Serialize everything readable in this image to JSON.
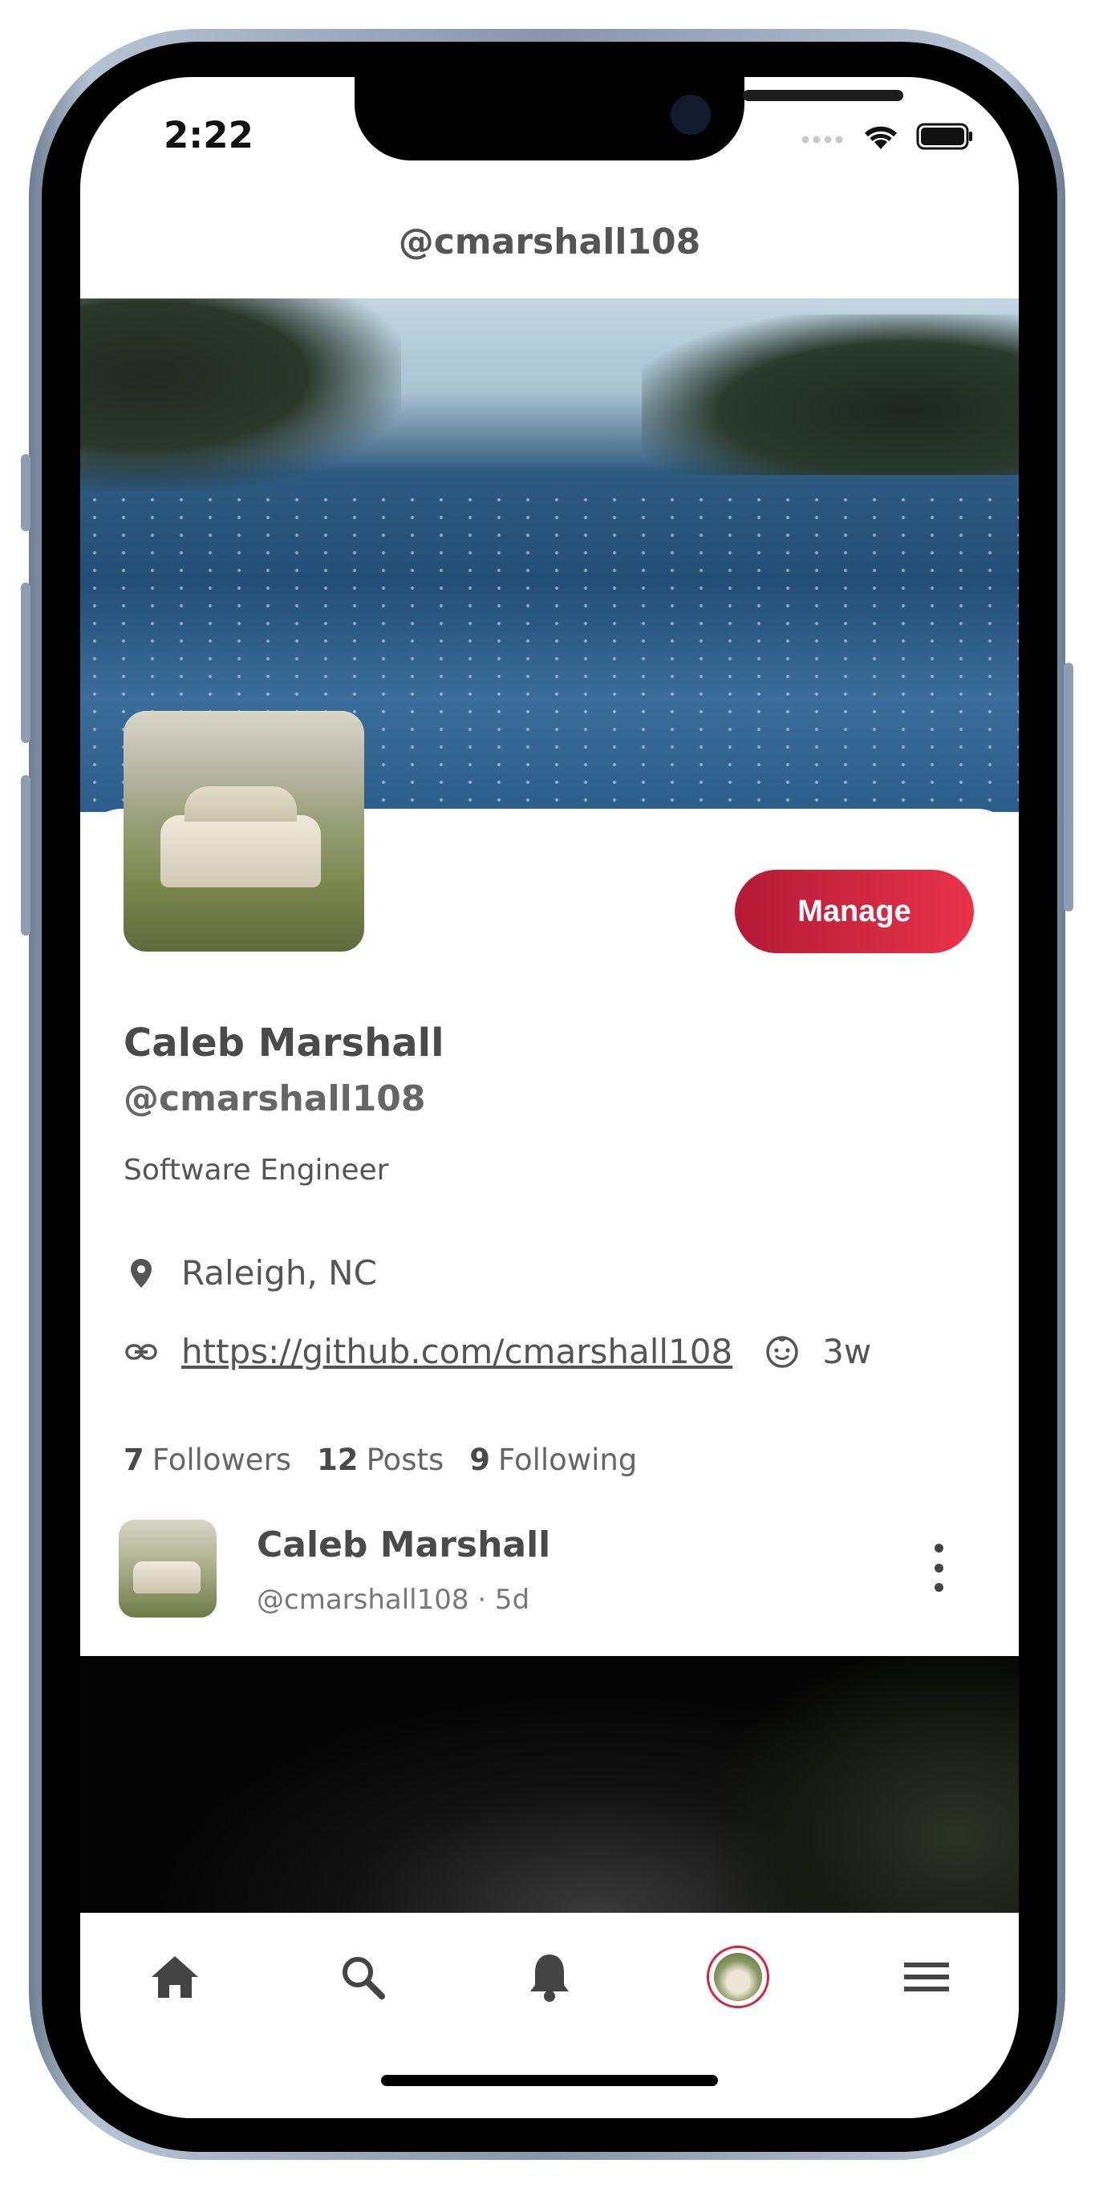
{
  "status_bar": {
    "time": "2:22"
  },
  "header": {
    "title": "@cmarshall108"
  },
  "profile": {
    "manage_label": "Manage",
    "name": "Caleb Marshall",
    "handle": "@cmarshall108",
    "bio": "Software Engineer",
    "location": "Raleigh, NC",
    "website": "https://github.com/cmarshall108",
    "joined": "3w"
  },
  "stats": {
    "followers_count": "7",
    "followers_label": "Followers",
    "posts_count": "12",
    "posts_label": "Posts",
    "following_count": "9",
    "following_label": "Following"
  },
  "post": {
    "author": "Caleb Marshall",
    "meta": "@cmarshall108 · 5d"
  },
  "tabbar": {
    "items": [
      "home-icon",
      "search-icon",
      "bell-icon",
      "profile-avatar",
      "menu-icon"
    ],
    "active": "profile-avatar"
  },
  "colors": {
    "accent": "#d6243c",
    "accent_start": "#b41a36",
    "accent_end": "#e8334a",
    "text": "#4a4a4a"
  }
}
